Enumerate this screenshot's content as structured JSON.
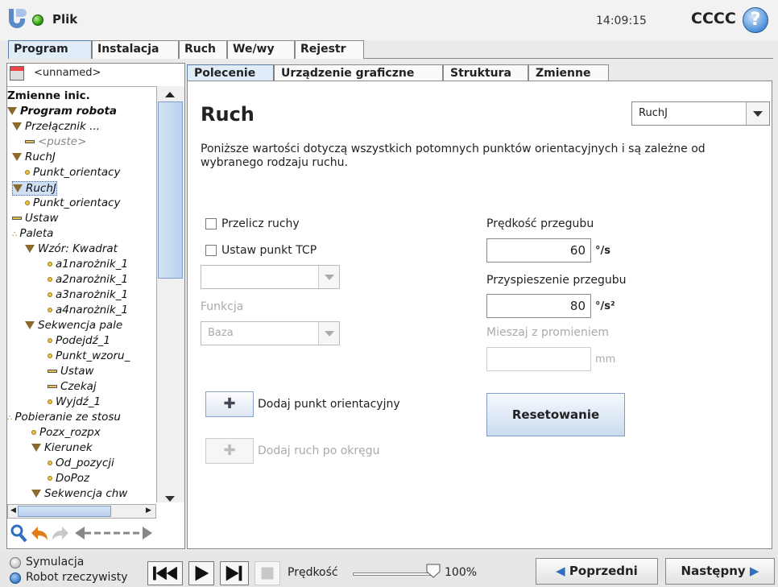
{
  "header": {
    "file_label": "Plik",
    "time": "14:09:15",
    "robot_name": "CCCC",
    "help_glyph": "?"
  },
  "main_tabs": [
    {
      "label": "Program",
      "active": true
    },
    {
      "label": "Instalacja",
      "active": false
    },
    {
      "label": "Ruch",
      "active": false
    },
    {
      "label": "We/wy",
      "active": false
    },
    {
      "label": "Rejestr",
      "active": false
    }
  ],
  "program": {
    "name": "<unnamed>"
  },
  "tree": [
    {
      "label": "Zmienne inic.",
      "bold": true,
      "italic": false,
      "icon": "none"
    },
    {
      "label": "Program robota",
      "bold": true,
      "icon": "triangle"
    },
    {
      "label": "Przełącznik ...",
      "icon": "triangle"
    },
    {
      "label": "<puste>",
      "icon": "bar",
      "dim": true
    },
    {
      "label": "RuchJ",
      "icon": "triangle"
    },
    {
      "label": "Punkt_orientacy",
      "icon": "dot"
    },
    {
      "label": "RuchJ",
      "icon": "triangle",
      "selected": true
    },
    {
      "label": "Punkt_orientacy",
      "icon": "dot"
    },
    {
      "label": "Ustaw",
      "icon": "bar"
    },
    {
      "label": "Paleta",
      "icon": "pallet"
    },
    {
      "label": "Wzór: Kwadrat",
      "icon": "triangle"
    },
    {
      "label": "a1narożnik_1",
      "icon": "dot"
    },
    {
      "label": "a2narożnik_1",
      "icon": "dot"
    },
    {
      "label": "a3narożnik_1",
      "icon": "dot"
    },
    {
      "label": "a4narożnik_1",
      "icon": "dot"
    },
    {
      "label": "Sekwencja pale",
      "icon": "triangle"
    },
    {
      "label": "Podejdź_1",
      "icon": "dot"
    },
    {
      "label": "Punkt_wzoru_",
      "icon": "dot"
    },
    {
      "label": "Ustaw",
      "icon": "bar"
    },
    {
      "label": "Czekaj",
      "icon": "bar"
    },
    {
      "label": "Wyjdź_1",
      "icon": "dot"
    },
    {
      "label": "Pobieranie ze stosu",
      "icon": "pallet"
    },
    {
      "label": "Pozx_rozpx",
      "icon": "dot"
    },
    {
      "label": "Kierunek",
      "icon": "triangle"
    },
    {
      "label": "Od_pozycji",
      "icon": "dot"
    },
    {
      "label": "DoPoz",
      "icon": "dot"
    },
    {
      "label": "Sekwencja chw",
      "icon": "triangle"
    }
  ],
  "sub_tabs": [
    {
      "label": "Polecenie",
      "active": true
    },
    {
      "label": "Urządzenie graficzne",
      "active": false
    },
    {
      "label": "Struktura",
      "active": false
    },
    {
      "label": "Zmienne",
      "active": false
    }
  ],
  "command": {
    "title": "Ruch",
    "move_type": "RuchJ",
    "description": "Poniższe wartości dotyczą wszystkich potomnych punktów orientacyjnych i są zależne od wybranego rodzaju ruchu.",
    "recalc_label": "Przelicz ruchy",
    "set_tcp_label": "Ustaw punkt TCP",
    "tcp_value": "",
    "function_label": "Funkcja",
    "function_value": "Baza",
    "joint_speed_label": "Prędkość przegubu",
    "joint_speed_value": "60",
    "joint_speed_unit": "°/s",
    "joint_accel_label": "Przyspieszenie przegubu",
    "joint_accel_value": "80",
    "joint_accel_unit": "°/s²",
    "blend_label": "Mieszaj z promieniem",
    "blend_value": "",
    "blend_unit": "mm",
    "add_waypoint_label": "Dodaj punkt orientacyjny",
    "add_circle_label": "Dodaj ruch po okręgu",
    "reset_label": "Resetowanie"
  },
  "footer": {
    "simulation_label": "Symulacja",
    "real_robot_label": "Robot rzeczywisty",
    "speed_label": "Prędkość",
    "speed_value": "100%",
    "speed_fraction": 1.0,
    "prev_label": "Poprzedni",
    "next_label": "Następny"
  },
  "colors": {
    "accent": "#4b8fd8",
    "tab_active": "#e0ecf8",
    "selected": "#cfe0f5"
  }
}
